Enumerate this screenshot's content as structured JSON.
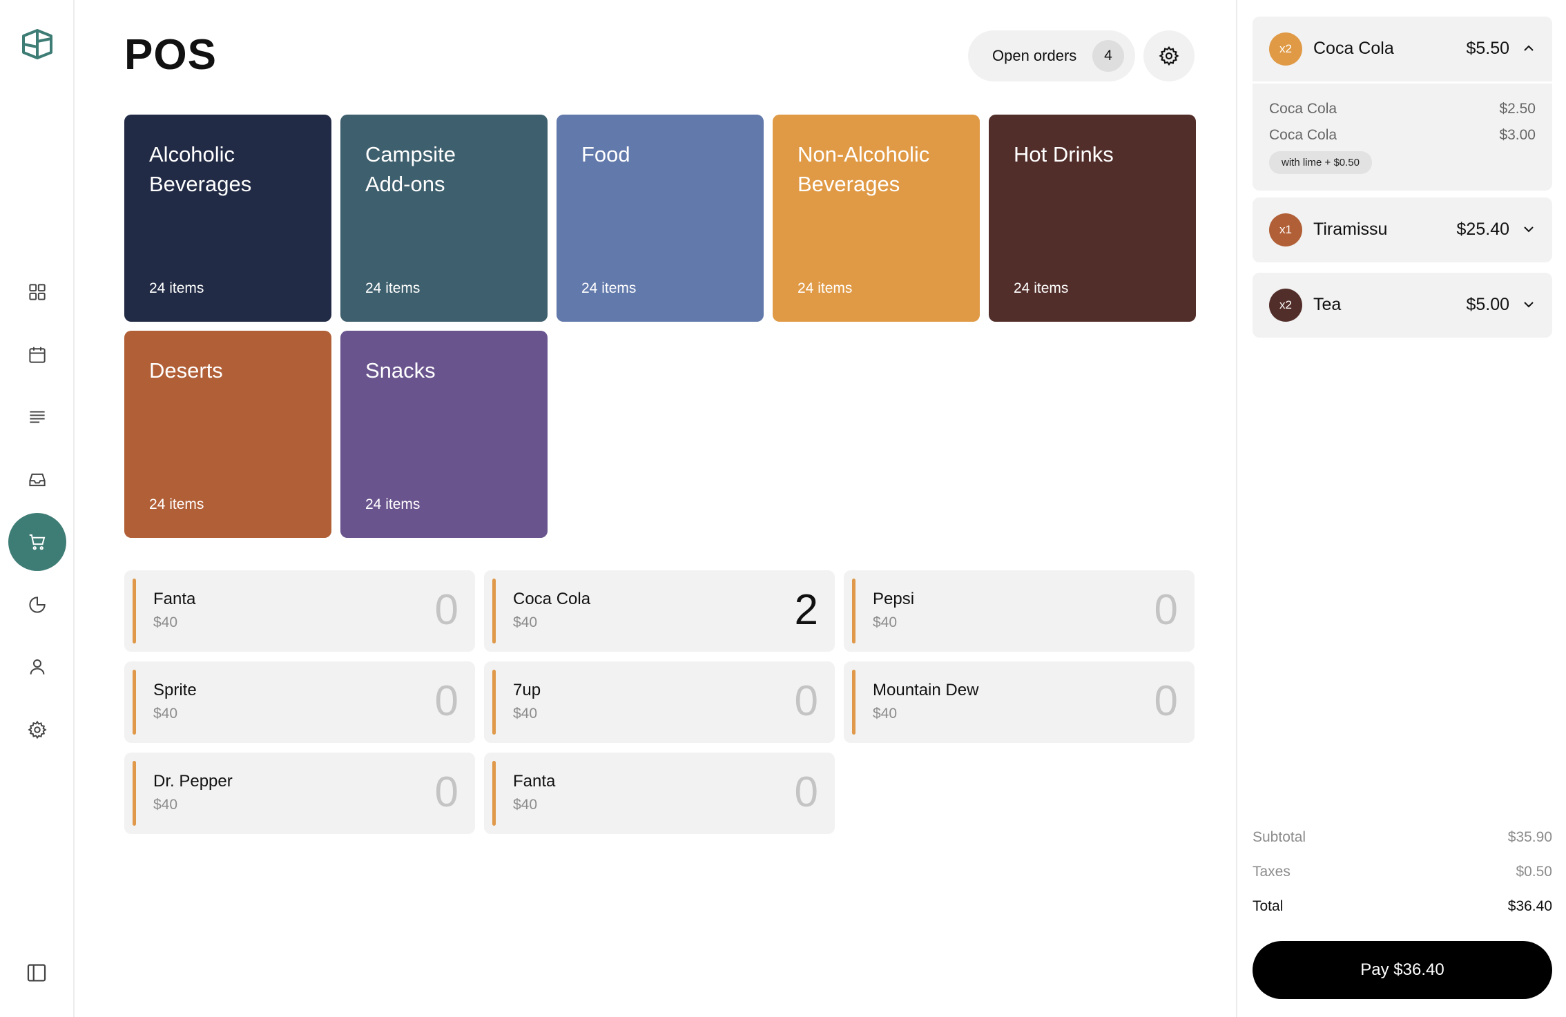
{
  "page": {
    "title": "POS"
  },
  "header": {
    "open_orders_label": "Open orders",
    "open_orders_count": "4"
  },
  "colors": {
    "accent": "#3e7d75",
    "product_bar": "#e0994a"
  },
  "sidebar": {
    "items": [
      {
        "icon": "grid-icon"
      },
      {
        "icon": "calendar-icon"
      },
      {
        "icon": "list-icon"
      },
      {
        "icon": "inbox-icon"
      },
      {
        "icon": "cart-icon",
        "active": true
      },
      {
        "icon": "pie-chart-icon"
      },
      {
        "icon": "user-icon"
      },
      {
        "icon": "gear-icon"
      }
    ]
  },
  "categories": [
    {
      "name": "Alcoholic\nBeverages",
      "items": "24 items",
      "color": "#222b45"
    },
    {
      "name": "Campsite\nAdd-ons",
      "items": "24 items",
      "color": "#3e5f6d"
    },
    {
      "name": "Food",
      "items": "24 items",
      "color": "#6279ab"
    },
    {
      "name": "Non-Alcoholic\nBeverages",
      "items": "24 items",
      "color": "#e09a46"
    },
    {
      "name": "Hot Drinks",
      "items": "24 items",
      "color": "#522e2a"
    },
    {
      "name": "Deserts",
      "items": "24 items",
      "color": "#b15f36"
    },
    {
      "name": "Snacks",
      "items": "24 items",
      "color": "#6a548e"
    }
  ],
  "products": [
    {
      "name": "Fanta",
      "price": "$40",
      "qty": "0"
    },
    {
      "name": "Coca Cola",
      "price": "$40",
      "qty": "2"
    },
    {
      "name": "Pepsi",
      "price": "$40",
      "qty": "0"
    },
    {
      "name": "Sprite",
      "price": "$40",
      "qty": "0"
    },
    {
      "name": "7up",
      "price": "$40",
      "qty": "0"
    },
    {
      "name": "Mountain Dew",
      "price": "$40",
      "qty": "0"
    },
    {
      "name": "Dr. Pepper",
      "price": "$40",
      "qty": "0"
    },
    {
      "name": "Fanta",
      "price": "$40",
      "qty": "0"
    }
  ],
  "order": {
    "items": [
      {
        "badge": "x2",
        "badge_color": "#e09a46",
        "name": "Coca Cola",
        "price": "$5.50",
        "expanded": true,
        "lines": [
          {
            "name": "Coca Cola",
            "price": "$2.50"
          },
          {
            "name": "Coca Cola",
            "price": "$3.00"
          }
        ],
        "modifier": "with lime + $0.50"
      },
      {
        "badge": "x1",
        "badge_color": "#b15f36",
        "name": "Tiramissu",
        "price": "$25.40",
        "expanded": false
      },
      {
        "badge": "x2",
        "badge_color": "#522e2a",
        "name": "Tea",
        "price": "$5.00",
        "expanded": false
      }
    ],
    "subtotal_label": "Subtotal",
    "subtotal": "$35.90",
    "taxes_label": "Taxes",
    "taxes": "$0.50",
    "total_label": "Total",
    "total": "$36.40",
    "pay_label": "Pay $36.40"
  }
}
